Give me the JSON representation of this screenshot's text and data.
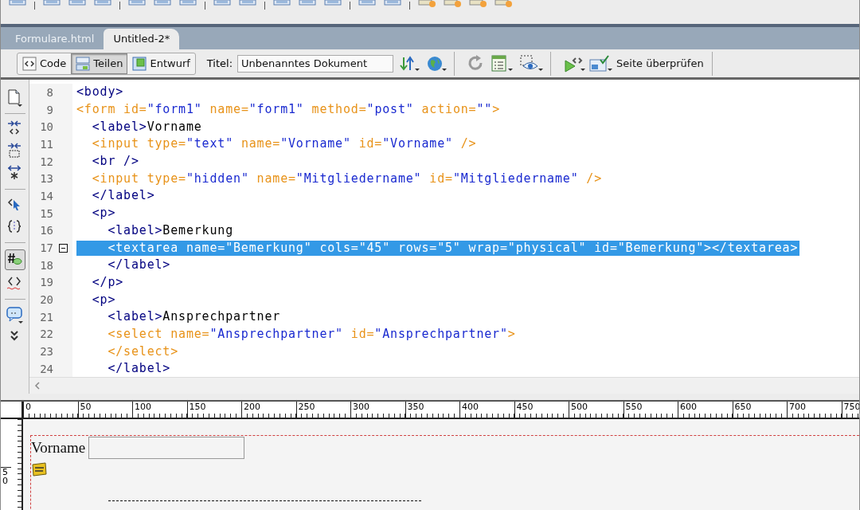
{
  "tabs": [
    {
      "label": "Formulare.html",
      "selected": false
    },
    {
      "label": "Untitled-2*",
      "selected": true
    }
  ],
  "view_buttons": [
    {
      "label": "Code",
      "kind": "code",
      "selected": false
    },
    {
      "label": "Teilen",
      "kind": "split",
      "selected": true
    },
    {
      "label": "Entwurf",
      "kind": "design",
      "selected": false
    }
  ],
  "title_field": {
    "label": "Titel:",
    "value": "Unbenanntes Dokument"
  },
  "check_page_button": {
    "label": "Seite überprüfen"
  },
  "code_lines": [
    {
      "number": "8",
      "fold": false,
      "selected": false,
      "tokens": [
        {
          "kind": "tag",
          "text": "<body>"
        }
      ]
    },
    {
      "number": "9",
      "fold": false,
      "selected": false,
      "tokens": [
        {
          "kind": "form",
          "text": "<form id="
        },
        {
          "kind": "value",
          "text": "\"form1\""
        },
        {
          "kind": "form",
          "text": " name="
        },
        {
          "kind": "value",
          "text": "\"form1\""
        },
        {
          "kind": "form",
          "text": " method="
        },
        {
          "kind": "value",
          "text": "\"post\""
        },
        {
          "kind": "form",
          "text": " action="
        },
        {
          "kind": "value",
          "text": "\"\""
        },
        {
          "kind": "form",
          "text": ">"
        }
      ]
    },
    {
      "number": "10",
      "fold": false,
      "selected": false,
      "tokens": [
        {
          "kind": "tag",
          "text": "  <label>"
        },
        {
          "kind": "text",
          "text": "Vorname"
        }
      ]
    },
    {
      "number": "11",
      "fold": false,
      "selected": false,
      "tokens": [
        {
          "kind": "form",
          "text": "  <input type="
        },
        {
          "kind": "value",
          "text": "\"text\""
        },
        {
          "kind": "form",
          "text": " name="
        },
        {
          "kind": "value",
          "text": "\"Vorname\""
        },
        {
          "kind": "form",
          "text": " id="
        },
        {
          "kind": "value",
          "text": "\"Vorname\""
        },
        {
          "kind": "form",
          "text": " />"
        }
      ]
    },
    {
      "number": "12",
      "fold": false,
      "selected": false,
      "tokens": [
        {
          "kind": "tag",
          "text": "  <br />"
        }
      ]
    },
    {
      "number": "13",
      "fold": false,
      "selected": false,
      "tokens": [
        {
          "kind": "form",
          "text": "  <input type="
        },
        {
          "kind": "value",
          "text": "\"hidden\""
        },
        {
          "kind": "form",
          "text": " name="
        },
        {
          "kind": "value",
          "text": "\"Mitgliedername\""
        },
        {
          "kind": "form",
          "text": " id="
        },
        {
          "kind": "value",
          "text": "\"Mitgliedername\""
        },
        {
          "kind": "form",
          "text": " />"
        }
      ]
    },
    {
      "number": "14",
      "fold": false,
      "selected": false,
      "tokens": [
        {
          "kind": "tag",
          "text": "  </label>"
        }
      ]
    },
    {
      "number": "15",
      "fold": false,
      "selected": false,
      "tokens": [
        {
          "kind": "tag",
          "text": "  <p>"
        }
      ]
    },
    {
      "number": "16",
      "fold": false,
      "selected": false,
      "tokens": [
        {
          "kind": "tag",
          "text": "    <label>"
        },
        {
          "kind": "text",
          "text": "Bemerkung"
        }
      ]
    },
    {
      "number": "17",
      "fold": true,
      "selected": true,
      "tokens": [
        {
          "kind": "form",
          "text": "    <textarea name="
        },
        {
          "kind": "value",
          "text": "\"Bemerkung\""
        },
        {
          "kind": "form",
          "text": " cols="
        },
        {
          "kind": "value",
          "text": "\"45\""
        },
        {
          "kind": "form",
          "text": " rows="
        },
        {
          "kind": "value",
          "text": "\"5\""
        },
        {
          "kind": "form",
          "text": " wrap="
        },
        {
          "kind": "value",
          "text": "\"physical\""
        },
        {
          "kind": "form",
          "text": " id="
        },
        {
          "kind": "value",
          "text": "\"Bemerkung\""
        },
        {
          "kind": "form",
          "text": "></textarea>"
        }
      ]
    },
    {
      "number": "18",
      "fold": false,
      "selected": false,
      "tokens": [
        {
          "kind": "tag",
          "text": "    </label>"
        }
      ]
    },
    {
      "number": "19",
      "fold": false,
      "selected": false,
      "tokens": [
        {
          "kind": "tag",
          "text": "  </p>"
        }
      ]
    },
    {
      "number": "20",
      "fold": false,
      "selected": false,
      "tokens": [
        {
          "kind": "tag",
          "text": "  <p>"
        }
      ]
    },
    {
      "number": "21",
      "fold": false,
      "selected": false,
      "tokens": [
        {
          "kind": "tag",
          "text": "    <label>"
        },
        {
          "kind": "text",
          "text": "Ansprechpartner"
        }
      ]
    },
    {
      "number": "22",
      "fold": false,
      "selected": false,
      "tokens": [
        {
          "kind": "form",
          "text": "    <select name="
        },
        {
          "kind": "value",
          "text": "\"Ansprechpartner\""
        },
        {
          "kind": "form",
          "text": " id="
        },
        {
          "kind": "value",
          "text": "\"Ansprechpartner\""
        },
        {
          "kind": "form",
          "text": ">"
        }
      ]
    },
    {
      "number": "23",
      "fold": false,
      "selected": false,
      "tokens": [
        {
          "kind": "form",
          "text": "    </select>"
        }
      ]
    },
    {
      "number": "24",
      "fold": false,
      "selected": false,
      "tokens": [
        {
          "kind": "tag",
          "text": "    </label>"
        }
      ]
    }
  ],
  "ruler": {
    "horizontal_labels": [
      "0",
      "50",
      "100",
      "150",
      "200",
      "250",
      "300",
      "350",
      "400",
      "450",
      "500",
      "550",
      "600",
      "650",
      "700",
      "750"
    ],
    "vertical_labels": [
      "50"
    ]
  },
  "design_view": {
    "label": "Vorname"
  }
}
